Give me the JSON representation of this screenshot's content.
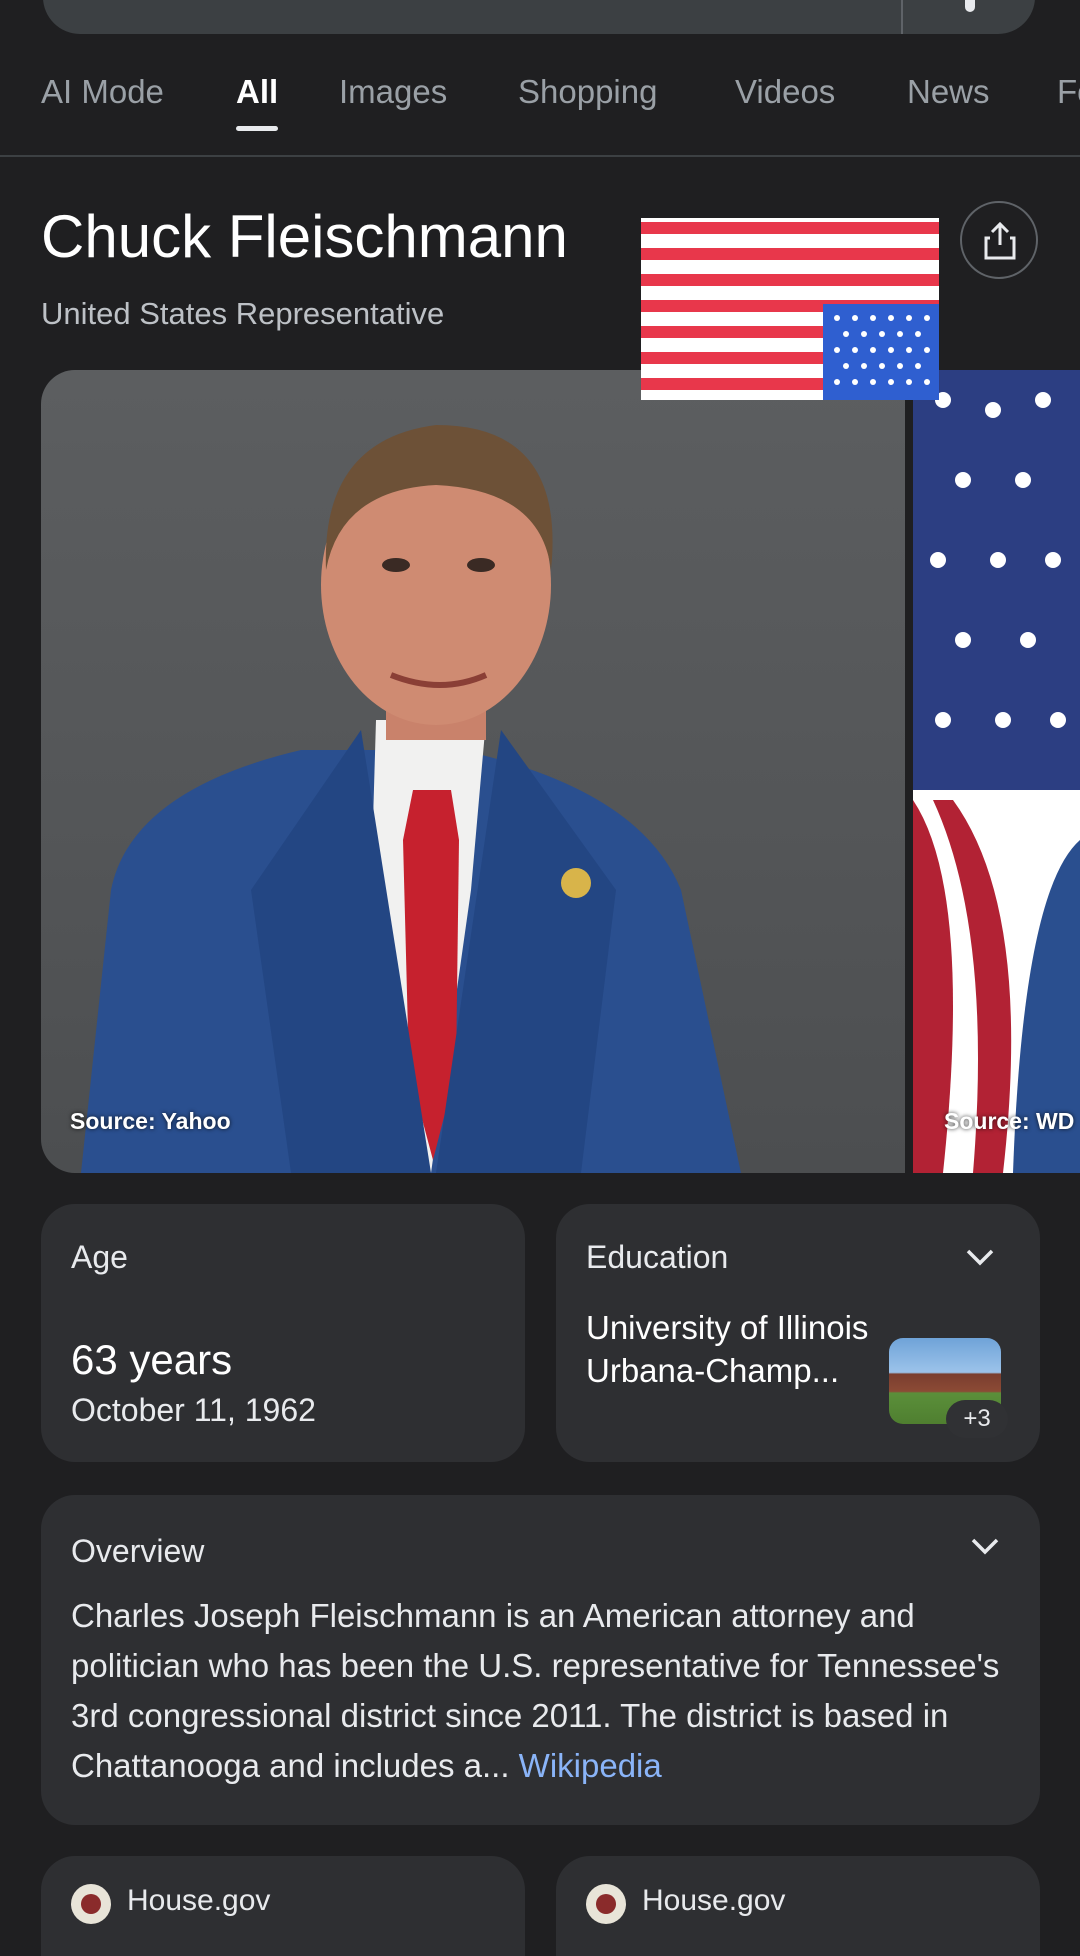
{
  "tabs": [
    {
      "label": "AI Mode",
      "active": false
    },
    {
      "label": "All",
      "active": true
    },
    {
      "label": "Images",
      "active": false
    },
    {
      "label": "Shopping",
      "active": false
    },
    {
      "label": "Videos",
      "active": false
    },
    {
      "label": "News",
      "active": false
    },
    {
      "label": "Fo",
      "active": false
    }
  ],
  "header": {
    "title": "Chuck Fleischmann",
    "subtitle": "United States Representative",
    "share_icon": "share-icon"
  },
  "images": [
    {
      "source": "Source: Yahoo"
    },
    {
      "source": "Source: WD"
    }
  ],
  "age_card": {
    "label": "Age",
    "value": "63 years",
    "date": "October 11, 1962"
  },
  "education_card": {
    "label": "Education",
    "school": "University of Illinois Urbana-Champ...",
    "more_count": "+3"
  },
  "overview_card": {
    "label": "Overview",
    "text": "Charles Joseph Fleischmann is an American attorney and politician who has been the U.S. representative for Tennessee's 3rd congressional district since 2011. The district is based in Chattanooga and includes a...",
    "link": "Wikipedia"
  },
  "sources": [
    {
      "name": "House.gov"
    },
    {
      "name": "House.gov"
    }
  ],
  "colors": {
    "background": "#1f1f21",
    "card": "#2e2f32",
    "link": "#8ab4f8"
  }
}
